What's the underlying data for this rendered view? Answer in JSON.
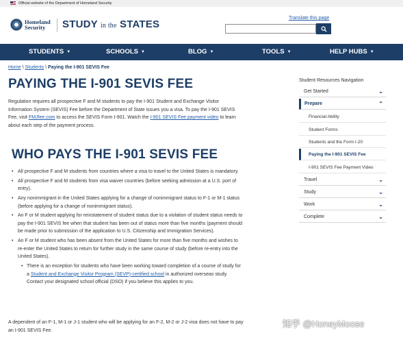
{
  "gov_banner": {
    "text": "Official website of the Department of Homeland Security"
  },
  "header": {
    "dhs_name": "Homeland Security",
    "site_title_a": "STUDY",
    "site_title_b": "in the",
    "site_title_c": "STATES",
    "translate": "Translate this page",
    "search_placeholder": "",
    "colors": {
      "navy": "#1d3e66",
      "link": "#1f5ba8"
    }
  },
  "nav": {
    "items": [
      {
        "label": "STUDENTS"
      },
      {
        "label": "SCHOOLS"
      },
      {
        "label": "BLOG"
      },
      {
        "label": "TOOLS"
      },
      {
        "label": "HELP HUBS"
      }
    ]
  },
  "breadcrumb": {
    "home": "Home",
    "sep": "\\",
    "students": "Students",
    "current": "Paying the I-901 SEVIS Fee"
  },
  "main": {
    "title": "PAYING THE I-901 SEVIS FEE",
    "intro_a": "Regulation requires all prospective F and M students to pay the I-901 Student and Exchange Visitor Information System (SEVIS) Fee before the Department of State issues you a visa. To pay the I-901 SEVIS Fee, visit ",
    "intro_link1": "FMJfee.com",
    "intro_b": " to access the SEVIS Form I-901. Watch the ",
    "intro_link2": "I-901 SEVIS Fee payment video",
    "intro_c": " to learn about each step of the payment process.",
    "section_title": "WHO PAYS THE I-901 SEVIS FEE",
    "bullets": [
      "All prospective F and M students from countries where a visa to travel to the United States is mandatory.",
      "All prospective F and M students from visa waiver countries (before seeking admission at a U.S. port of entry).",
      "Any nonimmigrant in the United States applying for a change of nonimmigrant status to F-1 or M-1 status (before applying for a change of nonimmigrant status).",
      "An F or M student applying for reinstatement of student status due to a violation of student status needs to pay the I-901 SEVIS fee when that student has been out of status more than five months (payment should be made prior to submission of the application to U.S. Citizenship and Immigration Services).",
      "An F or M student who has been absent from the United States for more than five months and wishes to re-enter the United States to return for further study in the same course of study (before re-entry into the United States)."
    ],
    "sub_a": "There is an exception for students who have been working toward completion of a course of study for a ",
    "sub_link": "Student and Exchange Visitor Program (SEVP)-certified school",
    "sub_b": " in authorized overseas study. Contact your designated school official (DSO) if you believe this applies to you.",
    "footer_note": "A dependent of an F-1, M-1 or J-1 student who will be applying for an F-2, M-2 or J-2 visa does not have to pay an I-901 SEVIS Fee."
  },
  "sidebar": {
    "title": "Student Resources Navigation",
    "items": [
      {
        "label": "Get Started",
        "icon": "chevron-down-icon"
      },
      {
        "label": "Prepare",
        "icon": "chevron-up-icon"
      },
      {
        "label": "Travel",
        "icon": "chevron-down-icon"
      },
      {
        "label": "Study",
        "icon": "chevron-down-icon"
      },
      {
        "label": "Work",
        "icon": "chevron-down-icon"
      },
      {
        "label": "Complete",
        "icon": "chevron-down-icon"
      }
    ],
    "sub_items": [
      {
        "label": "Financial Ability"
      },
      {
        "label": "Student Forms"
      },
      {
        "label": "Students and the Form I-20"
      },
      {
        "label": "Paying the I-901 SEVIS Fee"
      },
      {
        "label": "I-901 SEVIS Fee Payment Video"
      }
    ]
  },
  "watermark": {
    "text": "知乎 @HoneyMoose"
  }
}
